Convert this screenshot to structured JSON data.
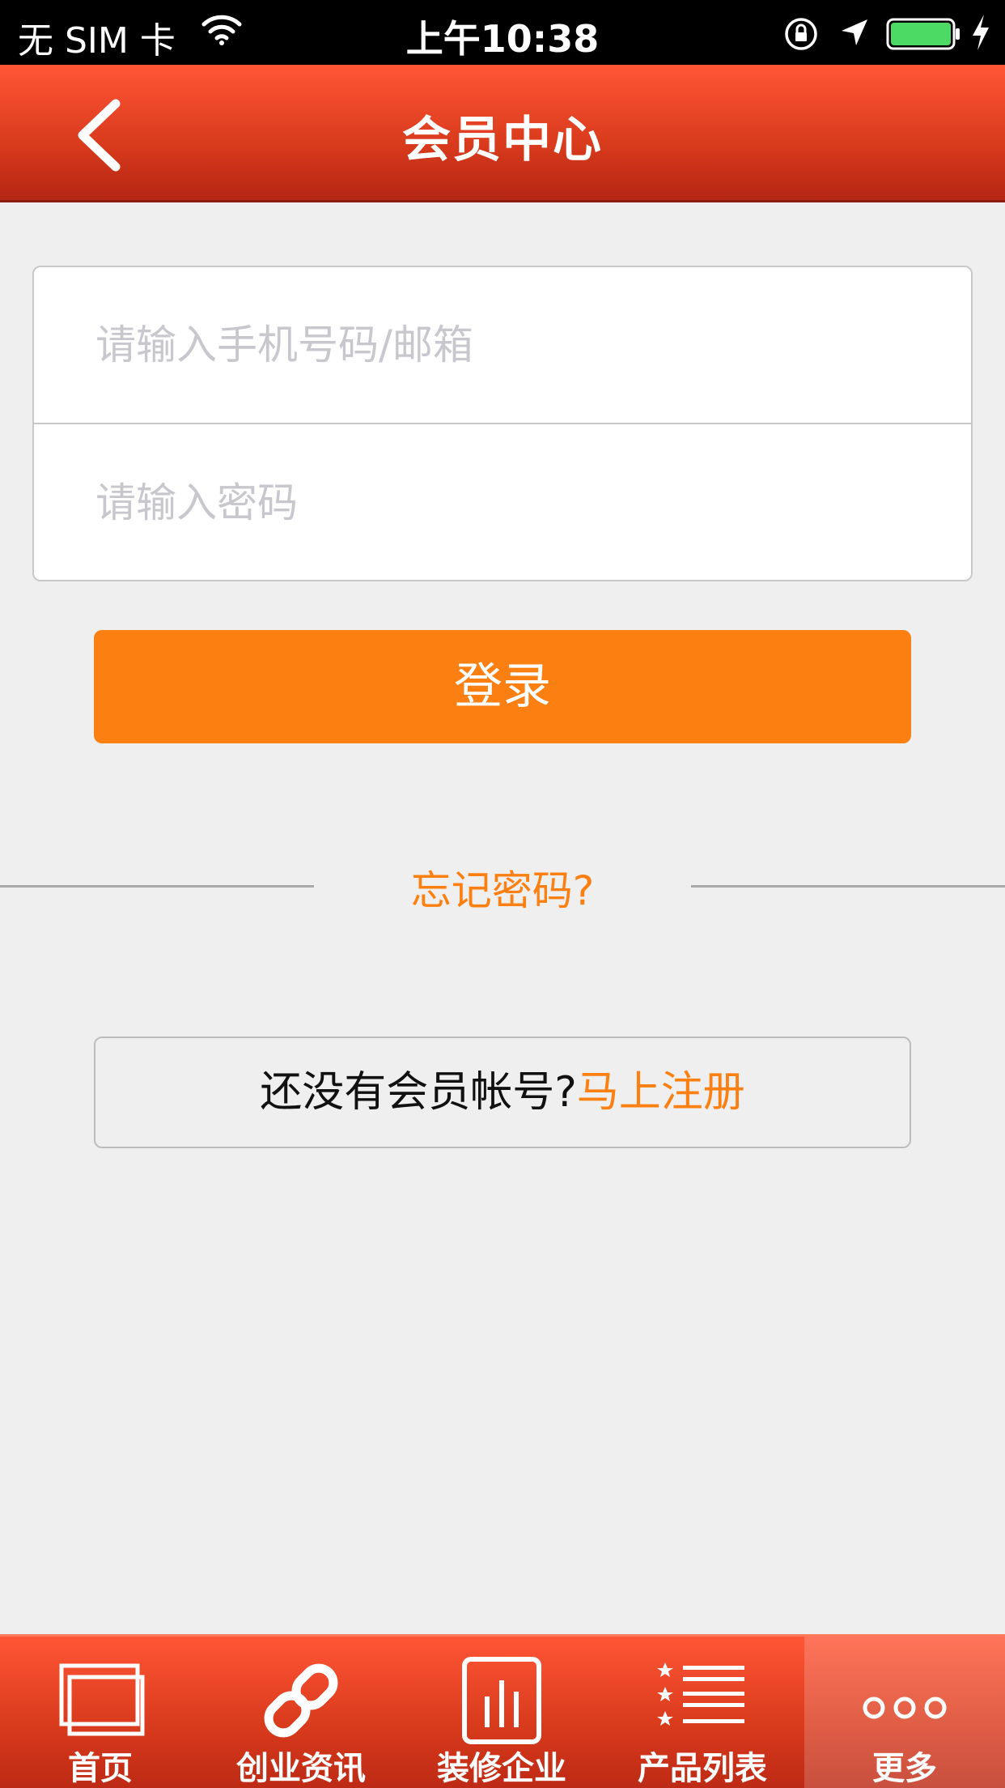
{
  "status_bar": {
    "carrier": "无 SIM 卡",
    "time": "上午10:38"
  },
  "nav": {
    "title": "会员中心"
  },
  "form": {
    "account_placeholder": "请输入手机号码/邮箱",
    "password_placeholder": "请输入密码"
  },
  "login_button": "登录",
  "forgot_password": "忘记密码?",
  "register": {
    "prompt": "还没有会员帐号?",
    "link": "马上注册"
  },
  "tabs": [
    {
      "label": "首页",
      "icon": "home-icon"
    },
    {
      "label": "创业资讯",
      "icon": "link-icon"
    },
    {
      "label": "装修企业",
      "icon": "chart-icon"
    },
    {
      "label": "产品列表",
      "icon": "list-icon"
    },
    {
      "label": "更多",
      "icon": "more-icon"
    }
  ],
  "colors": {
    "accent": "#fc7f11",
    "header": "#d83a1c",
    "background": "#efefef"
  }
}
